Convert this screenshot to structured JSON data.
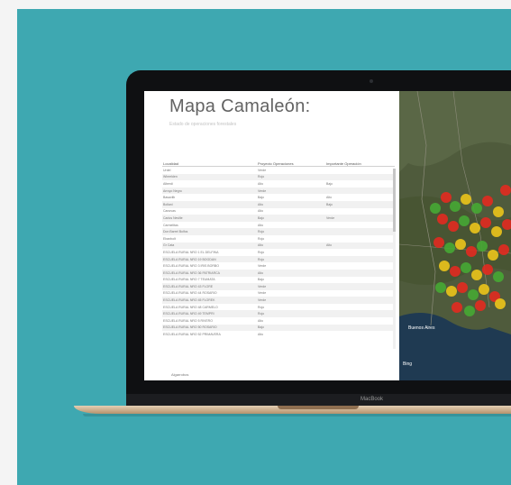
{
  "report": {
    "title": "Mapa Camaleón:",
    "subtitle": "Estado de operaciones forestales",
    "columns": [
      "Localidad",
      "Proyecto Operaciones",
      "Importante Operación"
    ],
    "rows": [
      [
        "Urdel",
        "Verde",
        ""
      ],
      [
        "Wheelden",
        "Rojo",
        ""
      ],
      [
        "Alberdi",
        "Alto",
        "Bajo"
      ],
      [
        "Arroyo Negro",
        "Verde",
        ""
      ],
      [
        "Basavilb",
        "Bajo",
        "Alto"
      ],
      [
        "Bollani",
        "Alto",
        "Bajo"
      ],
      [
        "Canovas",
        "Alto",
        ""
      ],
      [
        "Carlos Neville",
        "Bajo",
        "Verde"
      ],
      [
        "Carmelitas",
        "Alto",
        ""
      ],
      [
        "Don Barrel Bolfos",
        "Rojo",
        ""
      ],
      [
        "Ebanbolt",
        "Rojo",
        ""
      ],
      [
        "Gr Cata",
        "Alto",
        "Alto"
      ],
      [
        "ESCUELA RURAL NRO 1 EL DELFINA",
        "Rojo",
        ""
      ],
      [
        "ESCUELA RURAL NRO 19 BOGDAN",
        "Rojo",
        ""
      ],
      [
        "ESCUELA RURAL NRO 3 IRIS BORBO",
        "Verde",
        ""
      ],
      [
        "ESCUELA RURAL NRO 36 PATRIARCA",
        "Alto",
        ""
      ],
      [
        "ESCUELA RURAL NRO 7 TEUMATA",
        "Bajo",
        ""
      ],
      [
        "ESCUELA RURAL NRO 43 FLORE",
        "Verde",
        ""
      ],
      [
        "ESCUELA RURAL NRO 44 ROSARIO",
        "Verde",
        ""
      ],
      [
        "ESCUELA RURAL NRO 45 FLOREK",
        "Verde",
        ""
      ],
      [
        "ESCUELA RURAL NRO 48 CARMELO",
        "Rojo",
        ""
      ],
      [
        "ESCUELA RURAL NRO 49 TEMPRI",
        "Rojo",
        ""
      ],
      [
        "ESCUELA RURAL NRO 5 RIVERO",
        "Alto",
        ""
      ],
      [
        "ESCUELA RURAL NRO 50 ROSARIO",
        "Bajo",
        ""
      ],
      [
        "ESCUELA RURAL NRO 52 PRIMAVERA",
        "Alto",
        ""
      ]
    ],
    "footer": "Algarrobos"
  },
  "map": {
    "labels": [
      "Buenos Aires",
      "Bing"
    ],
    "marker_colors": {
      "red": "#e02b21",
      "yellow": "#e8c21b",
      "green": "#47a734"
    }
  },
  "laptop": {
    "brand": "MacBook"
  },
  "colors": {
    "background": "#3ea8b1"
  }
}
